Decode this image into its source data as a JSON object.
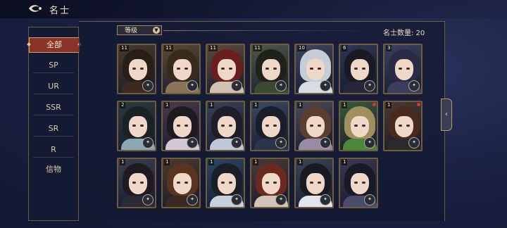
{
  "header": {
    "title": "名士"
  },
  "categories": [
    {
      "label": "全部",
      "active": true
    },
    {
      "label": "SP"
    },
    {
      "label": "UR"
    },
    {
      "label": "SSR"
    },
    {
      "label": "SR"
    },
    {
      "label": "R"
    },
    {
      "label": "信物"
    }
  ],
  "toolbar": {
    "sort_label": "等级",
    "count_text": "名士数量: 20"
  },
  "cards": [
    {
      "level": "11",
      "bg": "#4a3a2a",
      "hair": "#2a1e18",
      "body": "#3b2a20",
      "red_dot": false
    },
    {
      "level": "11",
      "bg": "#5a4a35",
      "hair": "#3a2a1e",
      "body": "#8a7358",
      "red_dot": false
    },
    {
      "level": "11",
      "bg": "#5e4a3a",
      "hair": "#6a1e1e",
      "body": "#d0c2b0",
      "red_dot": false
    },
    {
      "level": "11",
      "bg": "#4e5a4a",
      "hair": "#1e2218",
      "body": "#3d4a32",
      "red_dot": false
    },
    {
      "level": "10",
      "bg": "#3e4660",
      "hair": "#c8ccd4",
      "body": "#d8dce4",
      "red_dot": false
    },
    {
      "level": "6",
      "bg": "#2e3656",
      "hair": "#1a1a24",
      "body": "#26263a",
      "red_dot": false
    },
    {
      "level": "3",
      "bg": "#3a4260",
      "hair": "#2a2a44",
      "body": "#3d3d5e",
      "red_dot": false
    },
    {
      "level": "2",
      "bg": "#2c3a40",
      "hair": "#1a2226",
      "body": "#8aa8b4",
      "red_dot": false
    },
    {
      "level": "1",
      "bg": "#4a3a4a",
      "hair": "#1e1a22",
      "body": "#d4c8d4",
      "red_dot": false
    },
    {
      "level": "1",
      "bg": "#3a4258",
      "hair": "#1e1e2a",
      "body": "#c0c8d8",
      "red_dot": false
    },
    {
      "level": "1",
      "bg": "#3a4a62",
      "hair": "#1a1e2a",
      "body": "#2a344a",
      "red_dot": false
    },
    {
      "level": "1",
      "bg": "#4a4a5a",
      "hair": "#5a3e30",
      "body": "#9a8aa4",
      "red_dot": false
    },
    {
      "level": "1",
      "bg": "#3a5a3a",
      "hair": "#a09060",
      "body": "#4a8a3a",
      "red_dot": true
    },
    {
      "level": "1",
      "bg": "#4a3a30",
      "hair": "#4a2a1e",
      "body": "#2a2a2a",
      "red_dot": true
    },
    {
      "level": "1",
      "bg": "#3a3e50",
      "hair": "#1e1a20",
      "body": "#2a2a34",
      "red_dot": false
    },
    {
      "level": "1",
      "bg": "#4a3a2e",
      "hair": "#5a3420",
      "body": "#3a2a20",
      "red_dot": false
    },
    {
      "level": "1",
      "bg": "#2e4660",
      "hair": "#1a1e26",
      "body": "#c8d0dc",
      "red_dot": false
    },
    {
      "level": "1",
      "bg": "#4a3a38",
      "hair": "#6a2a20",
      "body": "#d4c4b8",
      "red_dot": false
    },
    {
      "level": "1",
      "bg": "#3a4658",
      "hair": "#1a1a22",
      "body": "#e4e4ec",
      "red_dot": false
    },
    {
      "level": "1",
      "bg": "#3a3a52",
      "hair": "#1a1a26",
      "body": "#4a4a6a",
      "red_dot": false
    }
  ],
  "icons": {
    "back": "back-arrow-icon",
    "sort_chevron": "chevron-down-icon",
    "side_expand": "chevron-left-icon"
  }
}
